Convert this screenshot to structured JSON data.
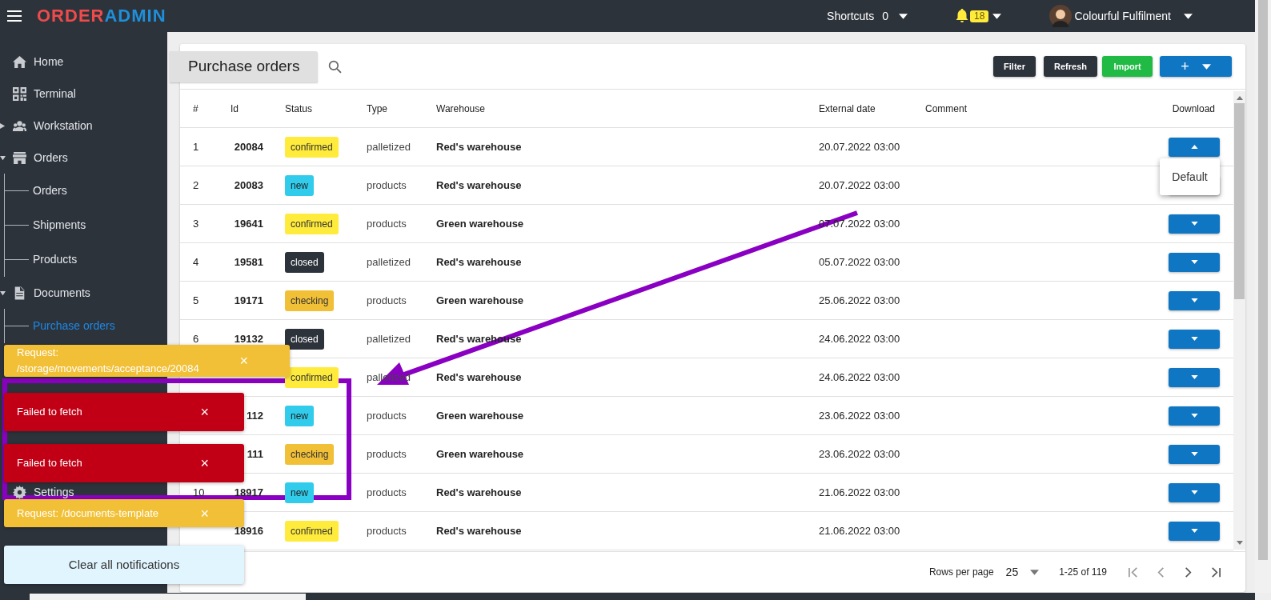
{
  "topbar": {
    "logo_left": "ORDER",
    "logo_right": "ADMIN",
    "shortcuts_label": "Shortcuts",
    "shortcuts_count": "0",
    "notifications_count": "18",
    "user": "Colourful Fulfilment"
  },
  "sidebar": {
    "items": [
      {
        "label": "Home"
      },
      {
        "label": "Terminal"
      },
      {
        "label": "Workstation",
        "expanded": false
      },
      {
        "label": "Orders",
        "expanded": true,
        "children": [
          {
            "label": "Orders",
            "selected": false
          },
          {
            "label": "Shipments",
            "selected": false
          },
          {
            "label": "Products",
            "selected": false
          }
        ]
      },
      {
        "label": "Documents",
        "expanded": true,
        "children": [
          {
            "label": "Purchase orders",
            "selected": true
          }
        ]
      },
      {
        "label": "Settings"
      }
    ]
  },
  "page": {
    "title": "Purchase orders",
    "buttons": [
      {
        "label": "Filter",
        "kind": "dark"
      },
      {
        "label": "Refresh",
        "kind": "dark"
      },
      {
        "label": "Import",
        "kind": "green"
      },
      {
        "label": "+",
        "kind": "blue"
      }
    ]
  },
  "table": {
    "columns": [
      "#",
      "Id",
      "Status",
      "Type",
      "Warehouse",
      "External date",
      "Comment",
      "Download"
    ],
    "rows": [
      {
        "num": "1",
        "id": "20084",
        "status": "confirmed",
        "type": "palletized",
        "warehouse": "Red's warehouse",
        "date": "20.07.2022 03:00",
        "expanded": true
      },
      {
        "num": "2",
        "id": "20083",
        "status": "new",
        "type": "products",
        "warehouse": "Red's warehouse",
        "date": "20.07.2022 03:00",
        "expanded": false
      },
      {
        "num": "3",
        "id": "19641",
        "status": "confirmed",
        "type": "products",
        "warehouse": "Green warehouse",
        "date": "07.07.2022 03:00",
        "expanded": false
      },
      {
        "num": "4",
        "id": "19581",
        "status": "closed",
        "type": "palletized",
        "warehouse": "Red's warehouse",
        "date": "05.07.2022 03:00",
        "expanded": false
      },
      {
        "num": "5",
        "id": "19171",
        "status": "checking",
        "type": "products",
        "warehouse": "Green warehouse",
        "date": "25.06.2022 03:00",
        "expanded": false
      },
      {
        "num": "6",
        "id": "19132",
        "status": "closed",
        "type": "palletized",
        "warehouse": "Red's warehouse",
        "date": "24.06.2022 03:00",
        "expanded": false
      },
      {
        "status": "confirmed",
        "type": "palletized",
        "warehouse": "Red's warehouse",
        "date": "24.06.2022 03:00",
        "expanded": false
      },
      {
        "id": "112",
        "status": "new",
        "type": "products",
        "warehouse": "Green warehouse",
        "date": "23.06.2022 03:00",
        "expanded": false
      },
      {
        "id": "111",
        "status": "checking",
        "type": "products",
        "warehouse": "Green warehouse",
        "date": "23.06.2022 03:00",
        "expanded": false
      },
      {
        "num": "10",
        "id": "18917",
        "status": "new",
        "type": "products",
        "warehouse": "Red's warehouse",
        "date": "21.06.2022 03:00",
        "expanded": false
      },
      {
        "id": "18916",
        "status": "confirmed",
        "type": "products",
        "warehouse": "Red's warehouse",
        "date": "21.06.2022 03:00",
        "expanded": false
      }
    ],
    "dropdown": {
      "items": [
        "Default"
      ]
    },
    "footer": {
      "rows_per_page_label": "Rows per page",
      "rows_per_page": "25",
      "range": "1-25 of 119"
    }
  },
  "notifications": [
    {
      "kind": "warning",
      "text": "Request: /storage/movements/acceptance/20084",
      "close": "×"
    },
    {
      "kind": "error",
      "text": "Failed to fetch",
      "close": "×"
    },
    {
      "kind": "error",
      "text": "Failed to fetch",
      "close": "×"
    },
    {
      "kind": "warning",
      "text": "Request: /documents-template",
      "close": "×"
    }
  ],
  "clear_all": "Clear all notifications"
}
